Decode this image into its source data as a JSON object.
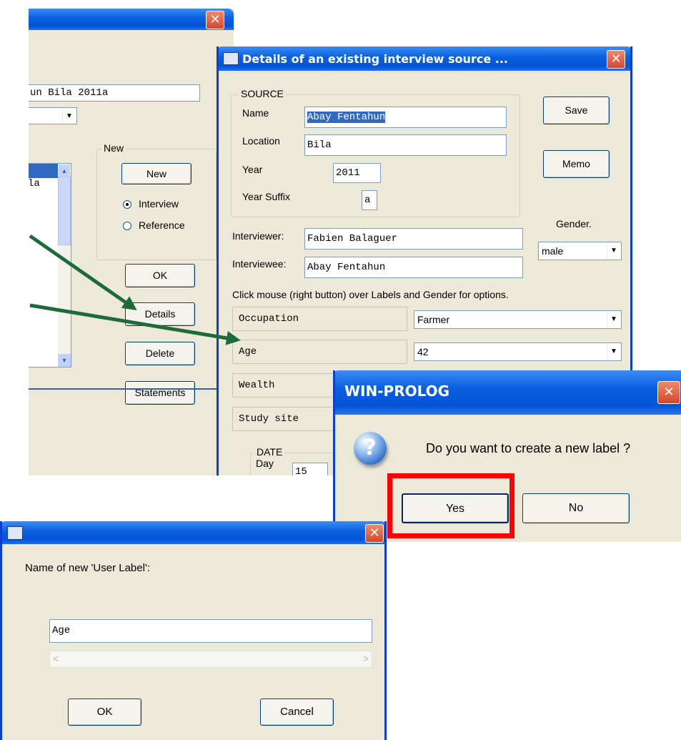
{
  "back_window": {
    "title": "",
    "source_text": "un Bila 2011a",
    "list_text": "la",
    "new_group_label": "New",
    "new_button": "New",
    "radio_interview": "Interview",
    "radio_reference": "Reference",
    "ok_button": "OK",
    "details_button": "Details",
    "delete_button": "Delete",
    "statements_button": "Statements"
  },
  "details_dialog": {
    "title": "Details of an existing interview source ...",
    "source_group": "SOURCE",
    "name_label": "Name",
    "name_value": "Abay Fentahun",
    "location_label": "Location",
    "location_value": "Bila",
    "year_label": "Year",
    "year_value": "2011",
    "year_suffix_label": "Year Suffix",
    "year_suffix_value": "a",
    "save_button": "Save",
    "memo_button": "Memo",
    "gender_label": "Gender.",
    "gender_value": "male",
    "interviewer_label": "Interviewer:",
    "interviewer_value": "Fabien Balaguer",
    "interviewee_label": "Interviewee:",
    "interviewee_value": "Abay Fentahun",
    "hint": "Click mouse (right button) over Labels and Gender for options.",
    "labels": [
      {
        "name": "Occupation",
        "value": "Farmer"
      },
      {
        "name": "Age",
        "value": "42"
      },
      {
        "name": "Wealth",
        "value": ""
      },
      {
        "name": "Study site",
        "value": ""
      }
    ],
    "date_group": "DATE",
    "day_label": "Day",
    "day_value": "15"
  },
  "winprolog_dialog": {
    "title": "WIN-PROLOG",
    "message": "Do you want to create a new label ?",
    "yes_button": "Yes",
    "no_button": "No"
  },
  "label_dialog": {
    "title": "",
    "prompt": "Name of new 'User Label':",
    "input_value": "Age",
    "ok_button": "OK",
    "cancel_button": "Cancel"
  },
  "colors": {
    "arrow": "#1d6b3a",
    "highlight": "#ff0000",
    "titlebar": "#0a5fe0"
  }
}
